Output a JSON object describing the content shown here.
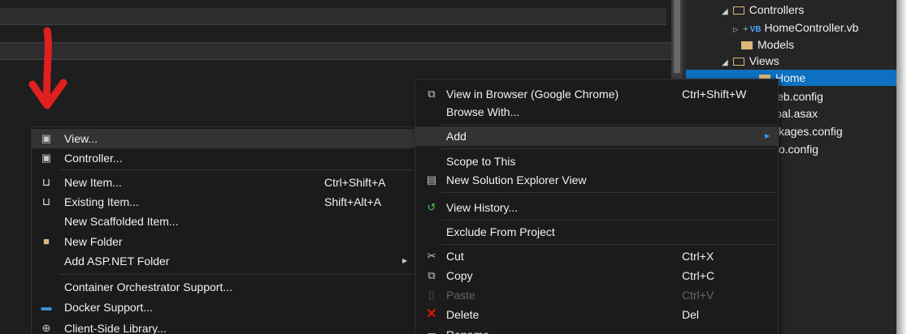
{
  "solution_explorer": {
    "items": [
      {
        "label": "Controllers"
      },
      {
        "label": "HomeController.vb",
        "badge": "VB"
      },
      {
        "label": "Models"
      },
      {
        "label": "Views"
      },
      {
        "label": "Home"
      },
      {
        "label": "web.config"
      },
      {
        "label": "pal.asax"
      },
      {
        "label": "kages.config"
      },
      {
        "label": "o.config"
      }
    ]
  },
  "submenu": {
    "items": [
      {
        "label": "View...",
        "icon": "view-icon"
      },
      {
        "label": "Controller...",
        "icon": "controller-icon"
      },
      {
        "label": "New Item...",
        "shortcut": "Ctrl+Shift+A",
        "icon": "new-item-icon"
      },
      {
        "label": "Existing Item...",
        "shortcut": "Shift+Alt+A",
        "icon": "existing-item-icon"
      },
      {
        "label": "New Scaffolded Item..."
      },
      {
        "label": "New Folder",
        "icon": "new-folder-icon"
      },
      {
        "label": "Add ASP.NET Folder",
        "has_submenu": true
      },
      {
        "label": "Container Orchestrator Support..."
      },
      {
        "label": "Docker Support...",
        "icon": "docker-icon"
      },
      {
        "label": "Client-Side Library...",
        "icon": "library-icon"
      }
    ]
  },
  "context_menu": {
    "items": [
      {
        "label": "View in Browser (Google Chrome)",
        "shortcut": "Ctrl+Shift+W",
        "icon": "browser-icon"
      },
      {
        "label": "Browse With..."
      },
      {
        "label": "Add",
        "has_submenu": true,
        "highlighted": true
      },
      {
        "label": "Scope to This"
      },
      {
        "label": "New Solution Explorer View",
        "icon": "solution-view-icon"
      },
      {
        "label": "View History...",
        "icon": "history-icon"
      },
      {
        "label": "Exclude From Project"
      },
      {
        "label": "Cut",
        "shortcut": "Ctrl+X",
        "icon": "cut-icon"
      },
      {
        "label": "Copy",
        "shortcut": "Ctrl+C",
        "icon": "copy-icon"
      },
      {
        "label": "Paste",
        "shortcut": "Ctrl+V",
        "icon": "paste-icon",
        "disabled": true
      },
      {
        "label": "Delete",
        "shortcut": "Del",
        "icon": "delete-icon"
      },
      {
        "label": "Rename",
        "icon": "rename-icon"
      }
    ]
  },
  "colors": {
    "accent_arrow": "#e02020",
    "selection": "#0e70c0",
    "menu_bg": "#1b1b1c",
    "delete_icon": "#e51400",
    "history_icon": "#4ec94e"
  }
}
